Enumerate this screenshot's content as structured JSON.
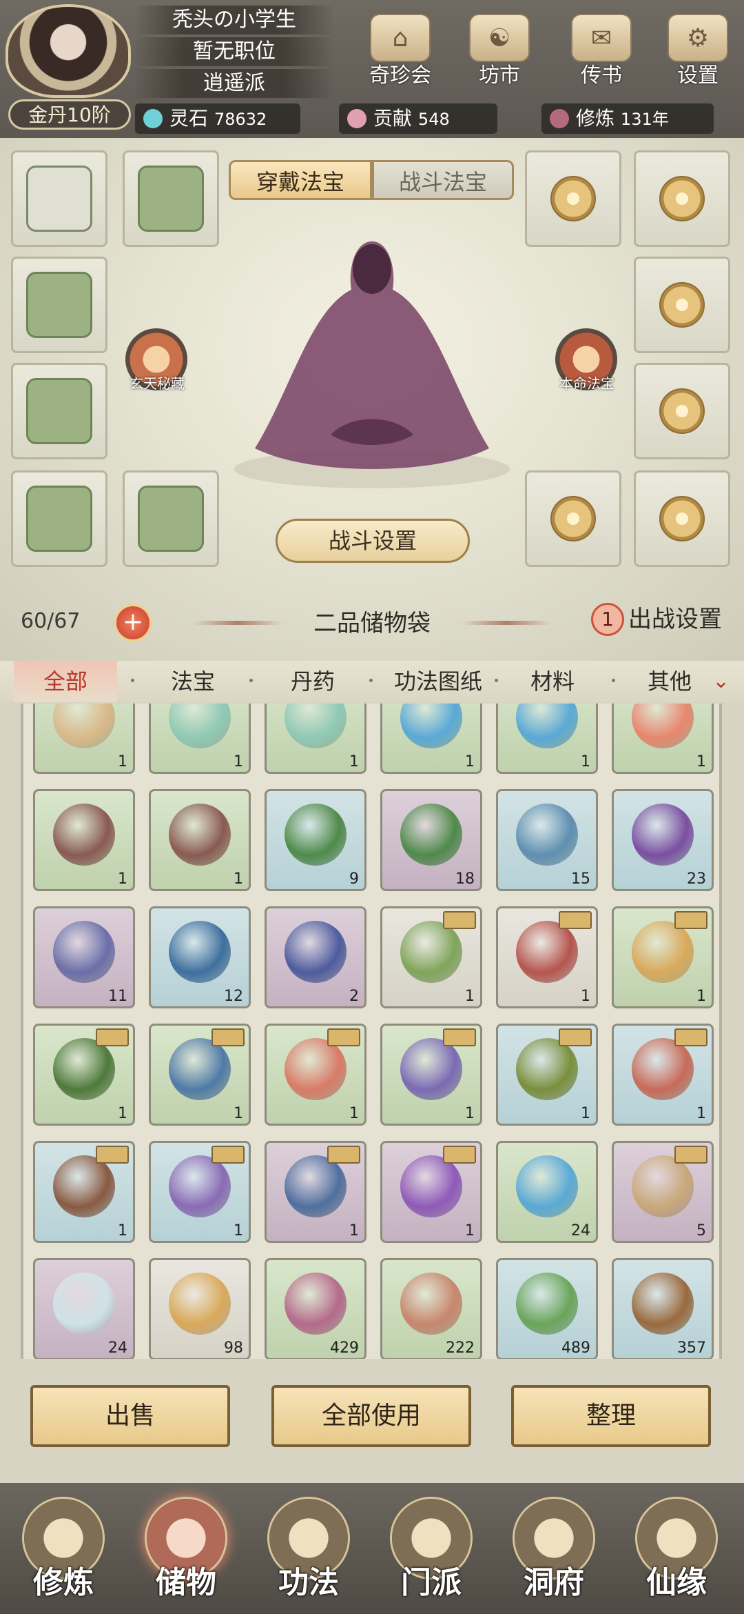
{
  "player": {
    "name": "秃头の小学生",
    "position": "暂无职位",
    "sect": "逍遥派",
    "realm": "金丹10阶"
  },
  "top_menu": [
    {
      "label": "奇珍会",
      "icon": "treasure-hall-icon"
    },
    {
      "label": "坊市",
      "icon": "market-icon"
    },
    {
      "label": "传书",
      "icon": "scroll-letter-icon"
    },
    {
      "label": "设置",
      "icon": "gear-icon"
    }
  ],
  "resources": {
    "stone_label": "灵石",
    "stone_value": "78632",
    "contrib_label": "贡献",
    "contrib_value": "548",
    "cultivate_label": "修炼",
    "cultivate_value": "131年"
  },
  "equip_tabs": {
    "active": "穿戴法宝",
    "inactive": "战斗法宝"
  },
  "specials": {
    "left": "玄天秘藏",
    "right": "本命法宝"
  },
  "battle_settings": "战斗设置",
  "bag": {
    "count": "60/67",
    "plus": "+",
    "title": "二品储物袋",
    "badge": "1",
    "fight_setting": "出战设置"
  },
  "filters": [
    "全部",
    "法宝",
    "丹药",
    "功法图纸",
    "材料",
    "其他"
  ],
  "items": [
    {
      "c": "green",
      "col": "#d9b98a",
      "n": "1"
    },
    {
      "c": "green",
      "col": "#8fc9b5",
      "n": "1"
    },
    {
      "c": "green",
      "col": "#8fc9b5",
      "n": "1"
    },
    {
      "c": "green",
      "col": "#5aa9d6",
      "n": "1"
    },
    {
      "c": "green",
      "col": "#5aa9d6",
      "n": "1"
    },
    {
      "c": "green",
      "col": "#e8866e",
      "n": "1"
    },
    {
      "c": "green",
      "col": "#8a5a52",
      "n": "1"
    },
    {
      "c": "green",
      "col": "#8a5a52",
      "n": "1"
    },
    {
      "c": "blue",
      "col": "#4f8a4a",
      "n": "9"
    },
    {
      "c": "purple",
      "col": "#4f8a4a",
      "n": "18"
    },
    {
      "c": "blue",
      "col": "#5f8fb0",
      "n": "15"
    },
    {
      "c": "blue",
      "col": "#7a4fa0",
      "n": "23"
    },
    {
      "c": "purple",
      "col": "#6a6fa8",
      "n": "11"
    },
    {
      "c": "blue",
      "col": "#3e6f9e",
      "n": "12"
    },
    {
      "c": "purple",
      "col": "#4d5c9e",
      "n": "2"
    },
    {
      "c": "grey",
      "col": "#7fa55a",
      "n": "1",
      "tag": true
    },
    {
      "c": "grey",
      "col": "#b5554e",
      "n": "1",
      "tag": true
    },
    {
      "c": "green",
      "col": "#d9a95a",
      "n": "1",
      "tag": true
    },
    {
      "c": "green",
      "col": "#4f7a3c",
      "n": "1",
      "tag": true
    },
    {
      "c": "green",
      "col": "#4f7aa8",
      "n": "1",
      "tag": true
    },
    {
      "c": "green",
      "col": "#d97a66",
      "n": "1",
      "tag": true
    },
    {
      "c": "green",
      "col": "#7a6ab5",
      "n": "1",
      "tag": true
    },
    {
      "c": "blue",
      "col": "#7a8f3c",
      "n": "1",
      "tag": true
    },
    {
      "c": "blue",
      "col": "#c86a58",
      "n": "1",
      "tag": true
    },
    {
      "c": "blue",
      "col": "#8a5a42",
      "n": "1",
      "tag": true
    },
    {
      "c": "blue",
      "col": "#8a6ab5",
      "n": "1",
      "tag": true
    },
    {
      "c": "purple",
      "col": "#4f6f9e",
      "n": "1",
      "tag": true
    },
    {
      "c": "purple",
      "col": "#8e5ab8",
      "n": "1",
      "tag": true
    },
    {
      "c": "green",
      "col": "#5aa9d6",
      "n": "24"
    },
    {
      "c": "purple",
      "col": "#c9a87a",
      "n": "5",
      "tag": true
    },
    {
      "c": "purple",
      "col": "#cfe2e6",
      "n": "24"
    },
    {
      "c": "grey",
      "col": "#d9a95a",
      "n": "98"
    },
    {
      "c": "green",
      "col": "#b56a8a",
      "n": "429"
    },
    {
      "c": "green",
      "col": "#c8866e",
      "n": "222"
    },
    {
      "c": "blue",
      "col": "#6aa55a",
      "n": "489"
    },
    {
      "c": "blue",
      "col": "#9a6a3e",
      "n": "357"
    }
  ],
  "actions": {
    "sell": "出售",
    "use_all": "全部使用",
    "sort": "整理"
  },
  "nav": [
    {
      "label": "修炼",
      "icon": "meditation-icon"
    },
    {
      "label": "储物",
      "icon": "storage-bag-icon",
      "active": true
    },
    {
      "label": "功法",
      "icon": "technique-scroll-icon"
    },
    {
      "label": "门派",
      "icon": "sect-gate-icon"
    },
    {
      "label": "洞府",
      "icon": "cave-mansion-icon"
    },
    {
      "label": "仙缘",
      "icon": "immortal-fate-icon"
    }
  ]
}
